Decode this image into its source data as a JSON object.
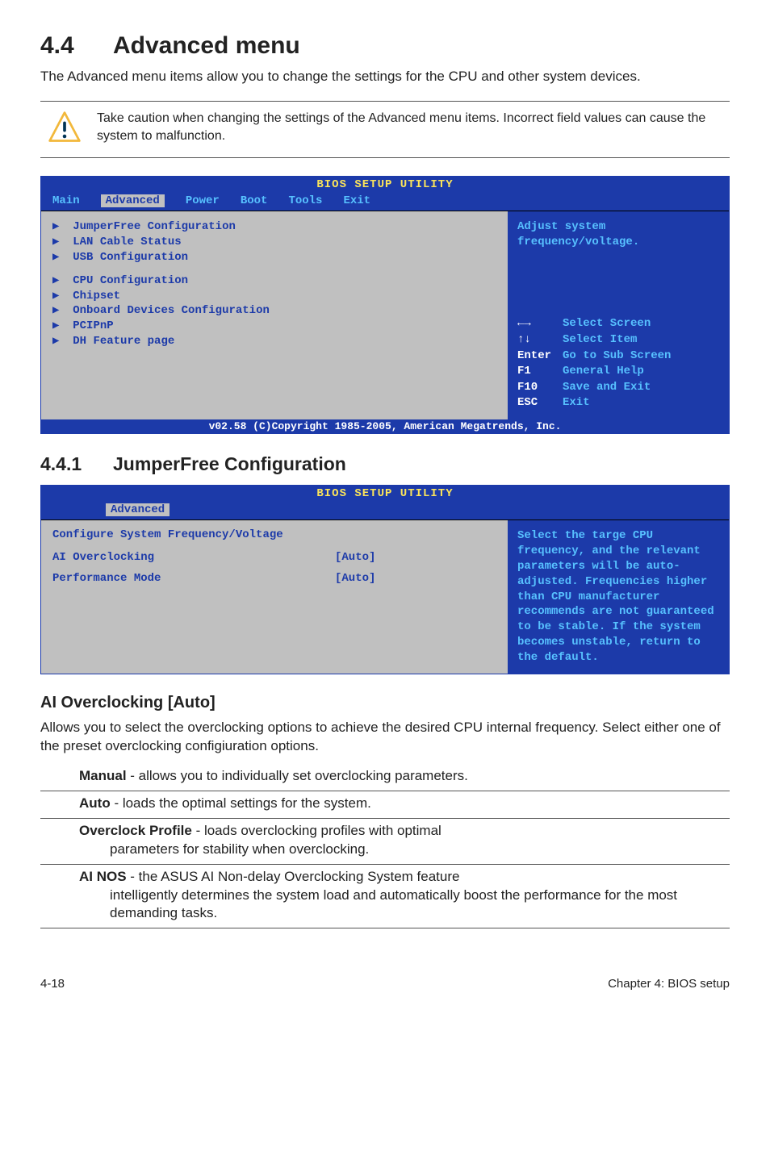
{
  "section": {
    "number": "4.4",
    "title": "Advanced menu"
  },
  "intro": "The Advanced menu items allow you to change the settings for the CPU and other system devices.",
  "caution": "Take caution when changing the settings of the Advanced menu items. Incorrect field values can cause the system to malfunction.",
  "bios1": {
    "title": "BIOS SETUP UTILITY",
    "tabs": [
      "Main",
      "Advanced",
      "Power",
      "Boot",
      "Tools",
      "Exit"
    ],
    "active_tab": "Advanced",
    "items_group1": [
      "JumperFree Configuration",
      "LAN Cable Status",
      "USB Configuration"
    ],
    "items_group2": [
      "CPU Configuration",
      "Chipset",
      "Onboard Devices Configuration",
      "PCIPnP",
      "DH Feature page"
    ],
    "right_desc": "Adjust system frequency/voltage.",
    "keys": [
      {
        "k": "←→",
        "v": "Select Screen"
      },
      {
        "k": "↑↓",
        "v": "Select Item"
      },
      {
        "k": "Enter",
        "v": "Go to Sub Screen"
      },
      {
        "k": "F1",
        "v": "General Help"
      },
      {
        "k": "F10",
        "v": "Save and Exit"
      },
      {
        "k": "ESC",
        "v": "Exit"
      }
    ],
    "footer": "v02.58 (C)Copyright 1985-2005, American Megatrends, Inc."
  },
  "subsection": {
    "number": "4.4.1",
    "title": "JumperFree Configuration"
  },
  "bios2": {
    "title": "BIOS SETUP UTILITY",
    "active_tab": "Advanced",
    "heading": "Configure System Frequency/Voltage",
    "rows": [
      {
        "label": "AI Overclocking",
        "value": "[Auto]"
      },
      {
        "label": "Performance Mode",
        "value": "[Auto]"
      }
    ],
    "right_desc": "Select the targe CPU frequency, and the relevant parameters will be auto-adjusted. Frequencies higher than CPU manufacturer recommends are not guaranteed to be stable. If the system becomes unstable, return to the default."
  },
  "ai_heading": "AI Overclocking [Auto]",
  "ai_body": "Allows you to select the overclocking options to achieve the desired CPU internal frequency. Select either one of the preset overclocking configiuration options.",
  "options": [
    {
      "name": "Manual",
      "rest": " - allows you to individually set overclocking parameters.",
      "cont": ""
    },
    {
      "name": "Auto",
      "rest": " - loads the optimal settings for the system.",
      "cont": ""
    },
    {
      "name": "Overclock Profile",
      "rest": " - loads overclocking profiles with optimal",
      "cont": "parameters for stability when overclocking."
    },
    {
      "name": "AI NOS",
      "rest": " - the ASUS AI Non-delay Overclocking System feature",
      "cont": "intelligently determines the system load and automatically boost the performance for the most demanding tasks."
    }
  ],
  "footer": {
    "left": "4-18",
    "right": "Chapter 4: BIOS setup"
  }
}
